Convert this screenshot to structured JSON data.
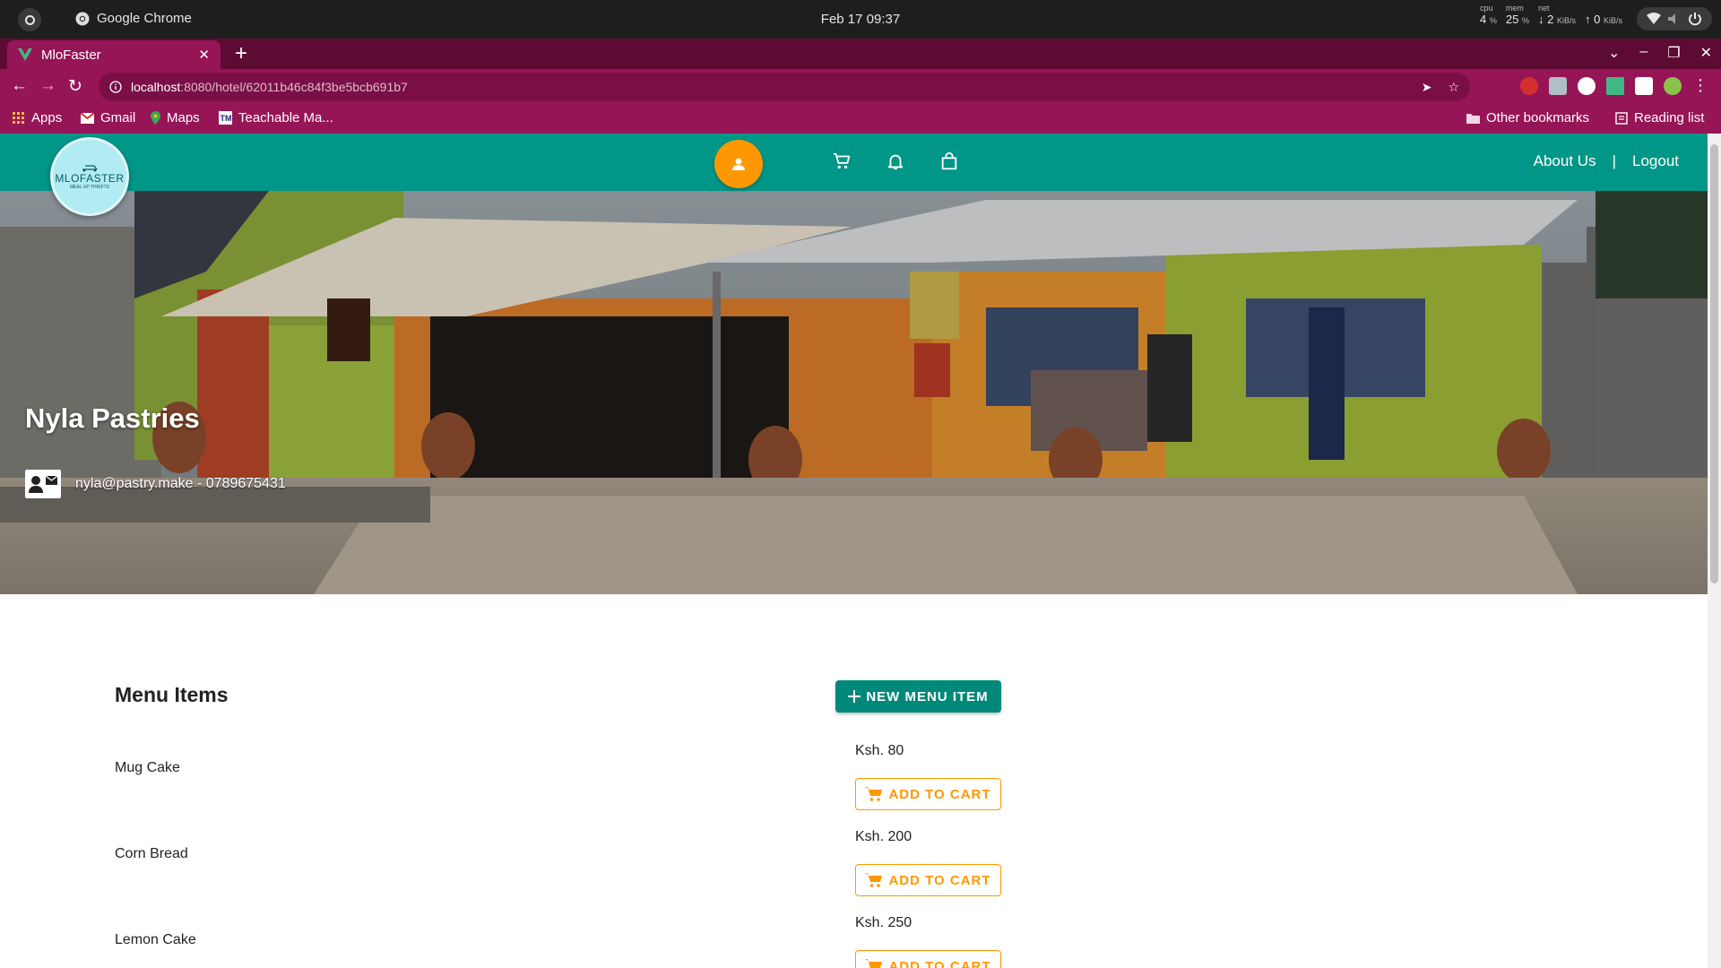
{
  "os": {
    "app_name": "Google Chrome",
    "clock": "Feb 17  09:37",
    "cpu_label": "cpu",
    "cpu_value": "4",
    "mem_label": "mem",
    "mem_value": "25",
    "net_label": "net",
    "net_down": "2",
    "net_up": "0",
    "percent": "%",
    "unit": "KiB/s"
  },
  "browser": {
    "tab_title": "MloFaster",
    "url_host": "localhost",
    "url_path": ":8080/hotel/62011b46c84f3be5bcb691b7",
    "bookmarks": [
      "Apps",
      "Gmail",
      "Maps",
      "Teachable Ma..."
    ],
    "other_bookmarks": "Other bookmarks",
    "reading_list": "Reading list"
  },
  "header": {
    "logo_text": "MLOFASTER",
    "logo_subtext": "MEAL UP THRIFTS",
    "nav_links": [
      "About Us",
      "|",
      "Logout"
    ]
  },
  "hotel": {
    "name": "Nyla Pastries",
    "contact": "nyla@pastry.make - 0789675431"
  },
  "menu": {
    "title": "Menu Items",
    "new_item_label": "NEW MENU ITEM",
    "add_to_cart_label": "ADD TO CART",
    "items": [
      {
        "name": "Mug Cake",
        "price": "Ksh. 80"
      },
      {
        "name": "Corn Bread",
        "price": "Ksh. 200"
      },
      {
        "name": "Lemon Cake",
        "price": "Ksh. 250"
      }
    ]
  },
  "colors": {
    "app_bar": "#009688",
    "accent": "#ff9800",
    "chrome_theme": "#961556",
    "button_primary": "#00897b"
  }
}
